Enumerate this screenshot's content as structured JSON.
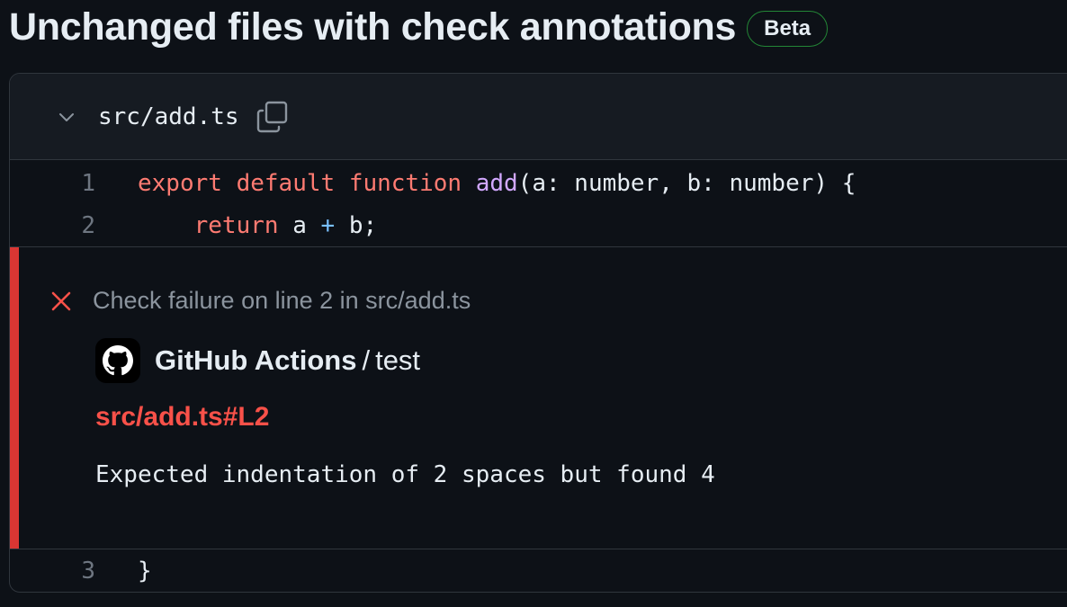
{
  "header": {
    "title": "Unchanged files with check annotations",
    "badge": "Beta"
  },
  "file": {
    "path": "src/add.ts",
    "icons": {
      "collapse": "chevron-down-icon",
      "copy": "copy-icon"
    }
  },
  "code_lines": [
    {
      "number": "1",
      "tokens": [
        {
          "text": "export",
          "kind": "keyword"
        },
        {
          "text": " ",
          "kind": "plain"
        },
        {
          "text": "default",
          "kind": "keyword"
        },
        {
          "text": " ",
          "kind": "plain"
        },
        {
          "text": "function",
          "kind": "keyword"
        },
        {
          "text": " ",
          "kind": "plain"
        },
        {
          "text": "add",
          "kind": "function"
        },
        {
          "text": "(a: number, b: number) {",
          "kind": "plain"
        }
      ]
    },
    {
      "number": "2",
      "tokens": [
        {
          "text": "    ",
          "kind": "plain"
        },
        {
          "text": "return",
          "kind": "keyword"
        },
        {
          "text": " a ",
          "kind": "plain"
        },
        {
          "text": "+",
          "kind": "operator"
        },
        {
          "text": " b;",
          "kind": "plain"
        }
      ]
    },
    {
      "number": "3",
      "tokens": [
        {
          "text": "}",
          "kind": "plain"
        }
      ]
    }
  ],
  "annotation": {
    "level": "failure",
    "title": "Check failure on line 2 in src/add.ts",
    "source_name": "GitHub Actions",
    "source_separator": "/",
    "source_job": "test",
    "link": "src/add.ts#L2",
    "message": "Expected indentation of 2 spaces but found 4",
    "icons": {
      "status": "x-icon",
      "avatar": "github-logo-icon"
    }
  },
  "colors": {
    "background": "#0d1117",
    "header_bg": "#161b22",
    "border": "#30363d",
    "keyword": "#ff7b72",
    "function": "#d2a8ff",
    "operator": "#79c0ff",
    "failure": "#da3633",
    "failure_link": "#f85149",
    "badge_border": "#238636",
    "muted": "#8b949e",
    "line_number": "#6e7681"
  }
}
